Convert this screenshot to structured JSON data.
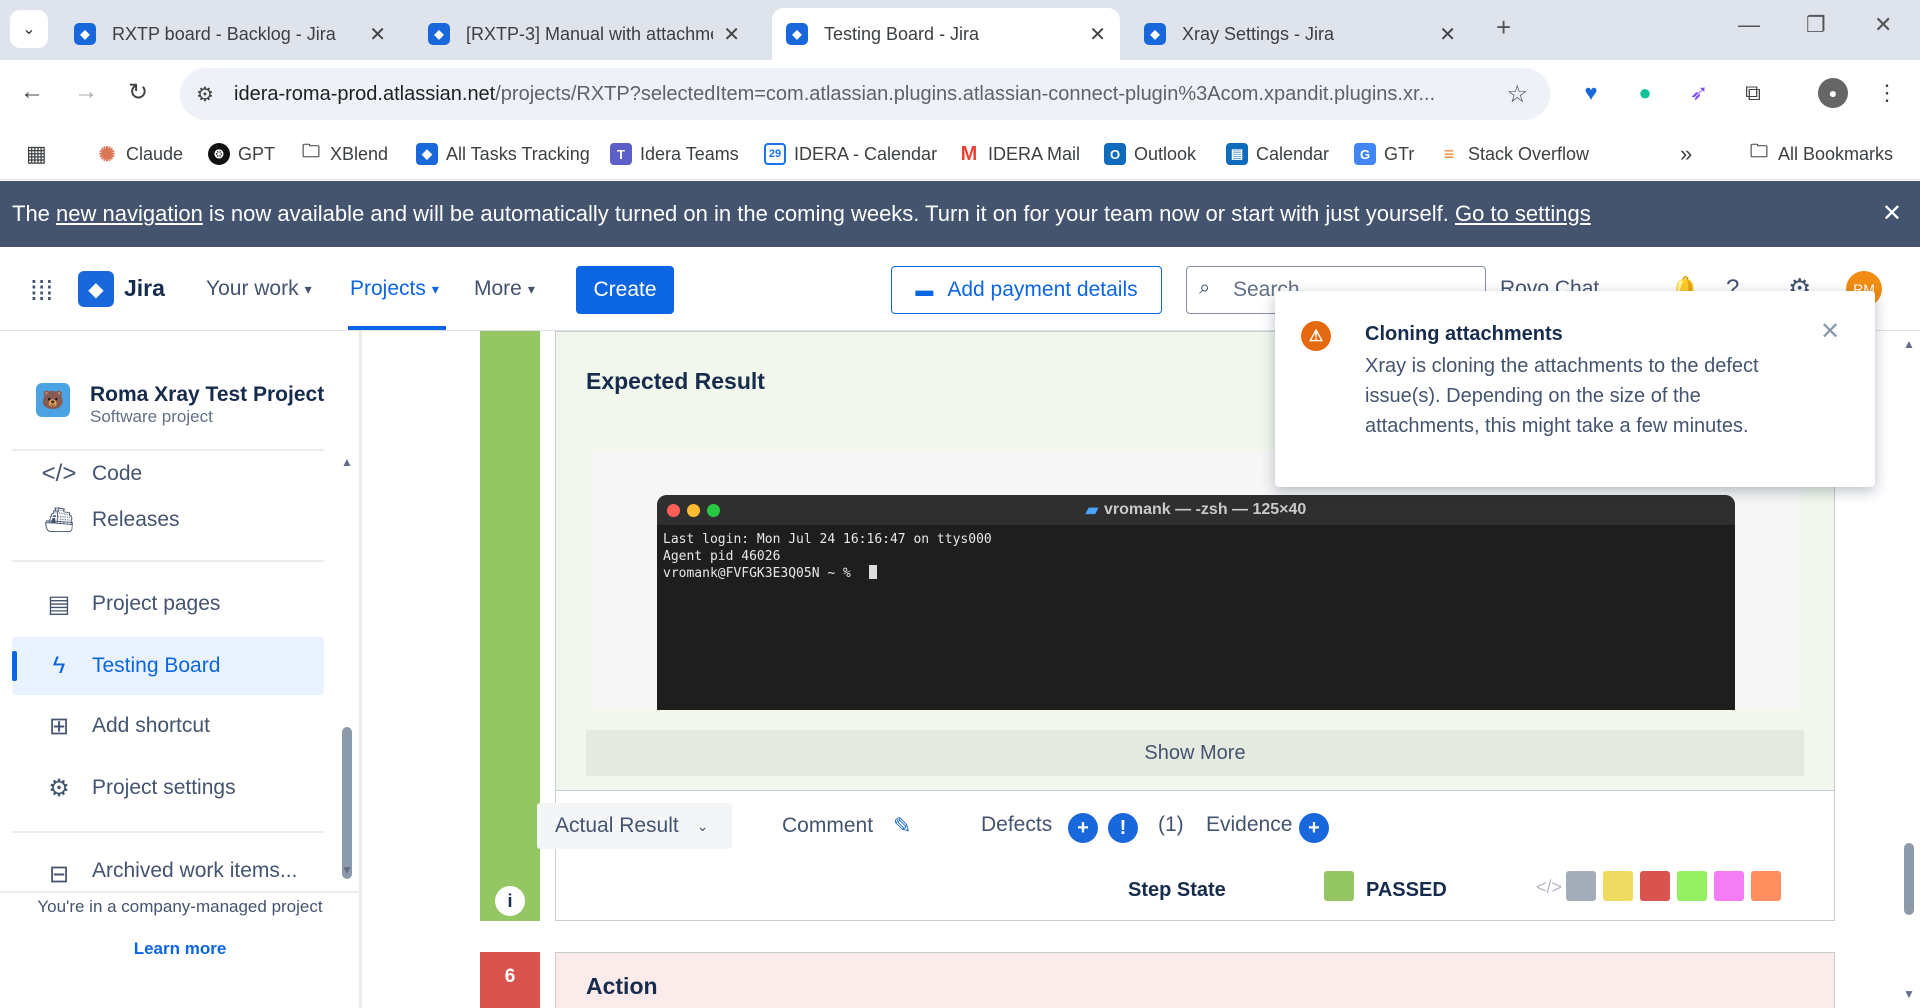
{
  "browser": {
    "tabs": [
      {
        "title": "RXTP board - Backlog - Jira"
      },
      {
        "title": "[RXTP-3] Manual with attachme"
      },
      {
        "title": "Testing Board - Jira"
      },
      {
        "title": "Xray Settings - Jira"
      }
    ],
    "url_host": "idera-roma-prod.atlassian.net",
    "url_rest": "/projects/RXTP?selectedItem=com.atlassian.plugins.atlassian-connect-plugin%3Acom.xpandit.plugins.xr...",
    "bookmarks": [
      "Claude",
      "GPT",
      "XBlend",
      "All Tasks Tracking",
      "Idera Teams",
      "IDERA - Calendar",
      "IDERA Mail",
      "Outlook",
      "Calendar",
      "GTr",
      "Stack Overflow"
    ],
    "all_bookmarks": "All Bookmarks",
    "calendar_day": "29"
  },
  "banner": {
    "text_before": "The ",
    "link1": "new navigation",
    "text_mid": " is now available and will be automatically turned on in the coming weeks. Turn it on for your team now or start with just yourself. ",
    "link2": "Go to settings"
  },
  "header": {
    "logo": "Jira",
    "your_work": "Your work",
    "projects": "Projects",
    "more": "More",
    "create": "Create",
    "add_payment": "Add payment details",
    "search_placeholder": "Search",
    "rovo_chat": "Rovo Chat",
    "avatar_initials": "RM"
  },
  "sidebar": {
    "project_name": "Roma Xray Test Project",
    "project_type": "Software project",
    "items": [
      "Code",
      "Releases",
      "Project pages",
      "Testing Board",
      "Add shortcut",
      "Project settings",
      "Archived work items..."
    ],
    "footer_text": "You're in a company-managed project",
    "learn_more": "Learn more"
  },
  "step": {
    "expected_result_title": "Expected Result",
    "terminal_title": "vromank — -zsh — 125×40",
    "terminal_lines": "Last login: Mon Jul 24 16:16:47 on ttys000\nAgent pid 46026\nvromank@FVFGK3E3Q05N ~ % ",
    "show_more": "Show More",
    "actual_result": "Actual Result",
    "comment": "Comment",
    "defects": "Defects",
    "defect_count": "(1)",
    "evidence": "Evidence",
    "step_state_label": "Step State",
    "step_state_value": "PASSED",
    "info_icon_text": "i",
    "next_step_number": "6",
    "next_step_action": "Action",
    "colors": {
      "passed": "#94c664",
      "failed": "#d9534f"
    }
  },
  "toast": {
    "title": "Cloning attachments",
    "body": "Xray is cloning the attachments to the defect issue(s). Depending on the size of the attachments, this might take a few minutes."
  }
}
